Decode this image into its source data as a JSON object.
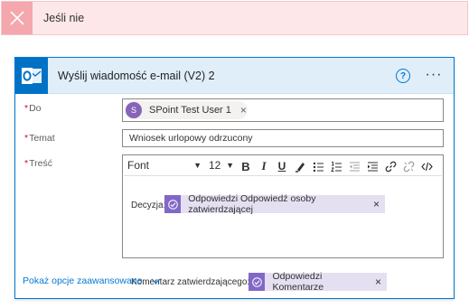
{
  "branch": {
    "title": "Jeśli nie",
    "close_icon": "close-icon",
    "color": "#fde7e9"
  },
  "card": {
    "title": "Wyślij wiadomość e-mail (V2) 2",
    "app_icon": "outlook-icon",
    "help_label": "?",
    "more_label": "···",
    "accent_color": "#0078d4"
  },
  "fields": {
    "to": {
      "label": "Do",
      "required_mark": "*",
      "chip": {
        "avatar_initial": "S",
        "name": "SPoint Test User 1",
        "remove": "×"
      }
    },
    "subject": {
      "label": "Temat",
      "required_mark": "*",
      "value": "Wniosek urlopowy odrzucony"
    },
    "body": {
      "label": "Treść",
      "required_mark": "*",
      "toolbar": {
        "font_label": "Font",
        "size_label": "12",
        "buttons": [
          "bold",
          "italic",
          "underline",
          "highlight",
          "bullets",
          "numbering",
          "outdent",
          "indent",
          "link",
          "unlink",
          "code-view"
        ]
      },
      "lines": [
        {
          "label": "Decyzja:",
          "token": "Odpowiedzi Odpowiedź osoby zatwierdzającej",
          "remove": "×"
        },
        {
          "label": "Komentarz zatwierdzającego:",
          "token": "Odpowiedzi Komentarze",
          "remove": "×"
        }
      ]
    }
  },
  "advanced_options": {
    "label": "Pokaż opcje zaawansowane"
  }
}
